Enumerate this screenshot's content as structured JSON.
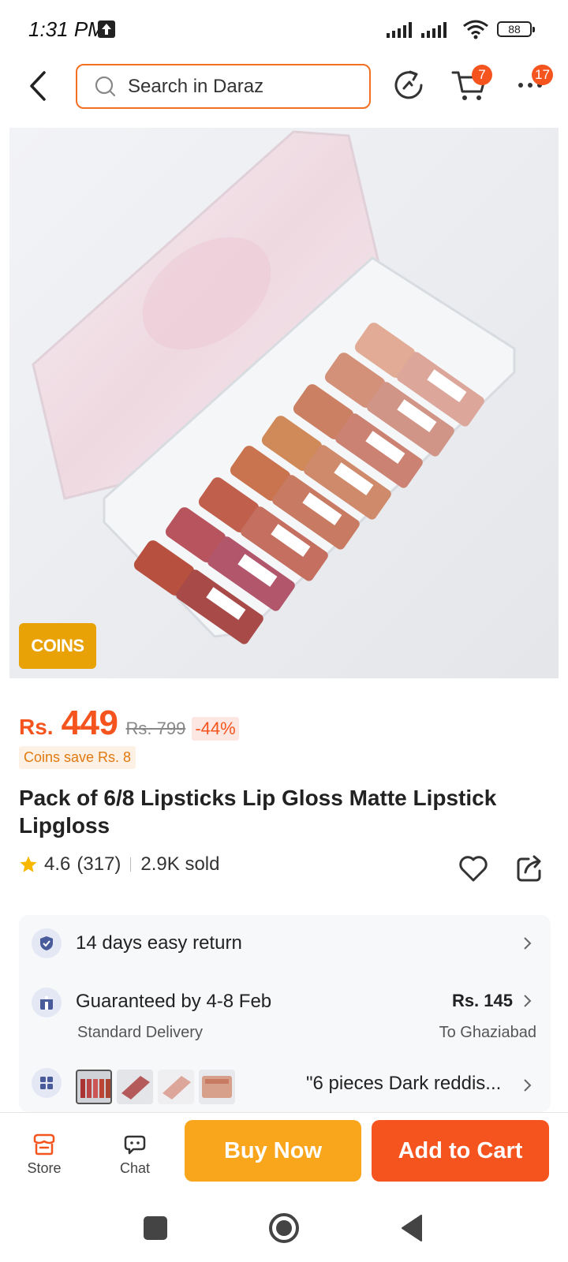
{
  "status_bar": {
    "time": "1:31 PM",
    "battery": "88"
  },
  "header": {
    "search_placeholder": "Search in Daraz",
    "cart_count": "7",
    "more_count": "17"
  },
  "product": {
    "coins_tag": "COINS",
    "price_currency": "Rs.",
    "price": "449",
    "original_price": "Rs. 799",
    "discount": "-44%",
    "coins_save": "Coins save Rs. 8",
    "title": "Pack of 6/8 Lipsticks Lip Gloss Matte Lipstick Lipgloss",
    "rating": "4.6",
    "reviews": "(317)",
    "sold": "2.9K sold",
    "rating_value": 4.6
  },
  "service": {
    "return_text": "14 days easy return",
    "delivery_text": "Guaranteed by 4-8 Feb",
    "delivery_sub": "Standard Delivery",
    "delivery_fee": "Rs. 145",
    "delivery_to": "To Ghaziabad",
    "variant_text": "\"6 pieces Dark reddis..."
  },
  "bottom_bar": {
    "store_label": "Store",
    "chat_label": "Chat",
    "buy_now": "Buy Now",
    "add_to_cart": "Add to Cart"
  },
  "colors": {
    "accent": "#f5541e",
    "buy_now": "#f9a61c",
    "coins": "#e8a205"
  },
  "icons": [
    "back-icon",
    "search-icon",
    "history-icon",
    "cart-icon",
    "more-icon",
    "star-icon",
    "heart-icon",
    "share-icon",
    "shield-check-icon",
    "delivery-icon",
    "variants-icon",
    "store-icon",
    "chat-icon"
  ]
}
